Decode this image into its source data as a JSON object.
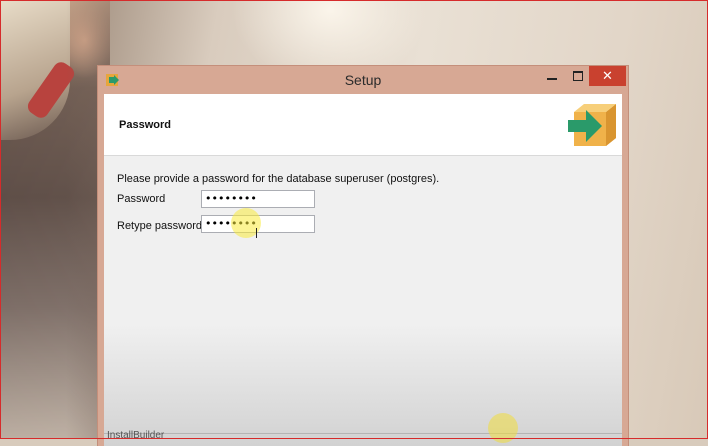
{
  "window": {
    "title": "Setup",
    "controls": {
      "minimize": "minimize",
      "maximize": "maximize",
      "close": "✕"
    }
  },
  "header": {
    "title": "Password",
    "logo_icon": "installer-box-arrow-icon"
  },
  "form": {
    "prompt": "Please provide a password for the database superuser (postgres).",
    "password_label": "Password",
    "password_value": "••••••••",
    "retype_label": "Retype password",
    "retype_value": "••••••••"
  },
  "footer": {
    "text": "InstallBuilder"
  },
  "colors": {
    "close_button": "#c9412f",
    "window_frame": "#d7a894",
    "logo_orange": "#f0b24a",
    "logo_arrow": "#2a9a6a"
  }
}
